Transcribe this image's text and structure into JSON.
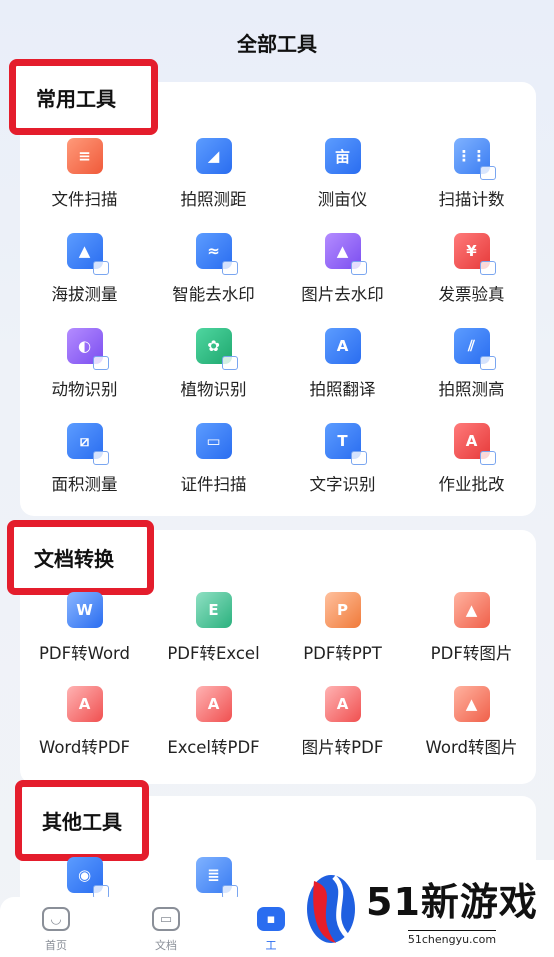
{
  "header": {
    "title": "全部工具"
  },
  "sections": {
    "common": {
      "label": "常用工具",
      "tools": [
        {
          "label": "文件扫描",
          "icon": "doc-scan-icon"
        },
        {
          "label": "拍照测距",
          "icon": "ruler-angle-icon"
        },
        {
          "label": "测亩仪",
          "icon": "field-measure-icon"
        },
        {
          "label": "扫描计数",
          "icon": "counter-grid-icon"
        },
        {
          "label": "海拔测量",
          "icon": "mountain-icon"
        },
        {
          "label": "智能去水印",
          "icon": "remove-watermark-icon"
        },
        {
          "label": "图片去水印",
          "icon": "image-clean-icon"
        },
        {
          "label": "发票验真",
          "icon": "invoice-icon"
        },
        {
          "label": "动物识别",
          "icon": "dog-icon"
        },
        {
          "label": "植物识别",
          "icon": "leaf-icon"
        },
        {
          "label": "拍照翻译",
          "icon": "translate-icon"
        },
        {
          "label": "拍照测高",
          "icon": "height-measure-icon"
        },
        {
          "label": "面积测量",
          "icon": "area-measure-icon"
        },
        {
          "label": "证件扫描",
          "icon": "id-card-icon"
        },
        {
          "label": "文字识别",
          "icon": "text-ocr-icon"
        },
        {
          "label": "作业批改",
          "icon": "homework-check-icon"
        }
      ]
    },
    "convert": {
      "label": "文档转换",
      "tools": [
        {
          "label": "PDF转Word",
          "glyph": "W"
        },
        {
          "label": "PDF转Excel",
          "glyph": "E"
        },
        {
          "label": "PDF转PPT",
          "glyph": "P"
        },
        {
          "label": "PDF转图片",
          "glyph": "▲"
        },
        {
          "label": "Word转PDF",
          "glyph": "A"
        },
        {
          "label": "Excel转PDF",
          "glyph": "A"
        },
        {
          "label": "图片转PDF",
          "glyph": "A"
        },
        {
          "label": "Word转图片",
          "glyph": "▲"
        }
      ]
    },
    "other": {
      "label": "其他工具"
    }
  },
  "bottom_nav": {
    "home": "首页",
    "docs": "文档",
    "tools": "工"
  },
  "watermark": {
    "brand": "51新游戏",
    "url": "51chengyu.com"
  },
  "colors": {
    "accent": "#2a6df0",
    "highlight": "#e41d2c"
  }
}
